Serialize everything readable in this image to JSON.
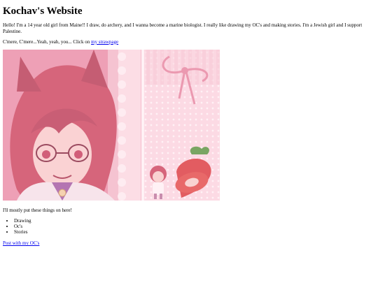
{
  "page": {
    "title": "Kochav's Website",
    "intro": "Hello! I'm a 14 year old girl from Maine!! I draw, do archery, and I wanna become a marine biologist. I really like drawing my OC's and making stories. I'm a Jewish girl and I support Palestine.",
    "cta_text": "C'mere, C'mere...Yeah, yeah, you... Click on ",
    "strawpage_link": "my strawpage",
    "mostly_text": "I'll mostly put these things on here!",
    "list_items": [
      "Drawing",
      "Oc's",
      "Stories"
    ],
    "post_link": "Post with my OC's"
  },
  "colors": {
    "link": "#0000ee",
    "hero_pink": "#f7c9d6",
    "hair_red": "#c8455c",
    "strawberry": "#d9383a"
  }
}
